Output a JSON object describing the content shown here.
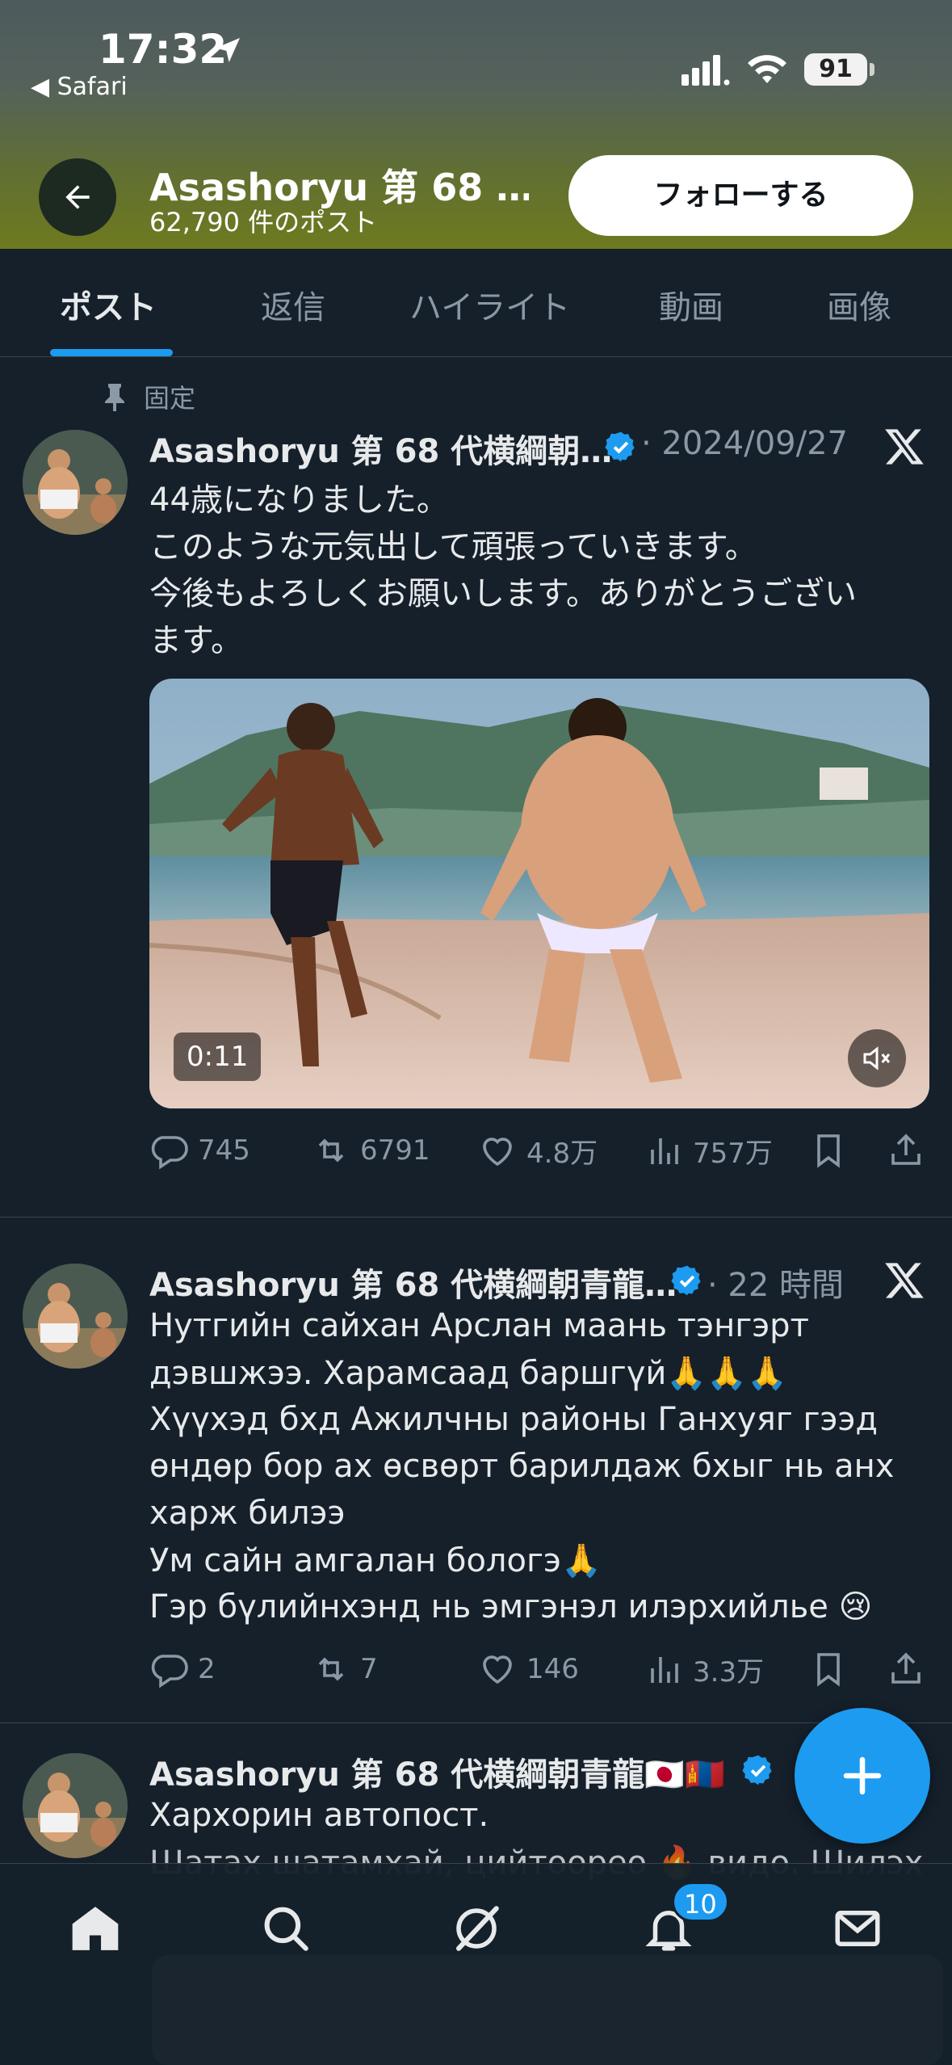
{
  "status_bar": {
    "time": "17:32",
    "back_app": "◀ Safari",
    "battery": "91"
  },
  "header": {
    "profile_name": "Asashoryu 第 68 …",
    "post_count": "62,790 件のポスト",
    "follow_label": "フォローする"
  },
  "tabs": [
    {
      "label": "ポスト"
    },
    {
      "label": "返信"
    },
    {
      "label": "ハイライト"
    },
    {
      "label": "動画"
    },
    {
      "label": "画像"
    }
  ],
  "posts": [
    {
      "pinned_label": "固定",
      "author": "Asashoryu 第 68 代横綱朝…",
      "time": "· 2024/09/27",
      "lines": [
        "44歳になりました。",
        "このような元気出して頑張っていきます。",
        "今後もよろしくお願いします。ありがとうござい",
        "ます。"
      ],
      "video_duration": "0:11",
      "replies": "745",
      "reposts": "6791",
      "likes": "4.8万",
      "views": "757万"
    },
    {
      "author": "Asashoryu 第 68 代横綱朝青龍…",
      "time": "· 22 時間",
      "lines": [
        "Нутгийн сайхан Арслан маань тэнгэрт",
        "дэвшжээ. Харамсаад баршгүй🙏🙏🙏",
        "Хүүхэд бхд Ажилчны районы Ганхуяг гээд",
        "өндөр бор ах өсвөрт барилдаж бхыг нь анх",
        "харж билээ",
        "Ум сайн амгалан бологэ🙏",
        "Гэр бүлийнхэнд нь эмгэнэл илэрхийлье 😢"
      ],
      "replies": "2",
      "reposts": "7",
      "likes": "146",
      "views": "3.3万"
    },
    {
      "author": "Asashoryu 第 68 代横綱朝青龍🇯🇵🇲🇳",
      "lines": [
        "Хархорин автопост.",
        "Шатах шатамхай, цийтоорео 🔥 видо. Шилэх"
      ]
    }
  ],
  "bottom_nav": {
    "notifications_badge": "10"
  },
  "colors": {
    "accent": "#1d9bf0",
    "background": "#15202b",
    "muted": "#8b98a5"
  }
}
